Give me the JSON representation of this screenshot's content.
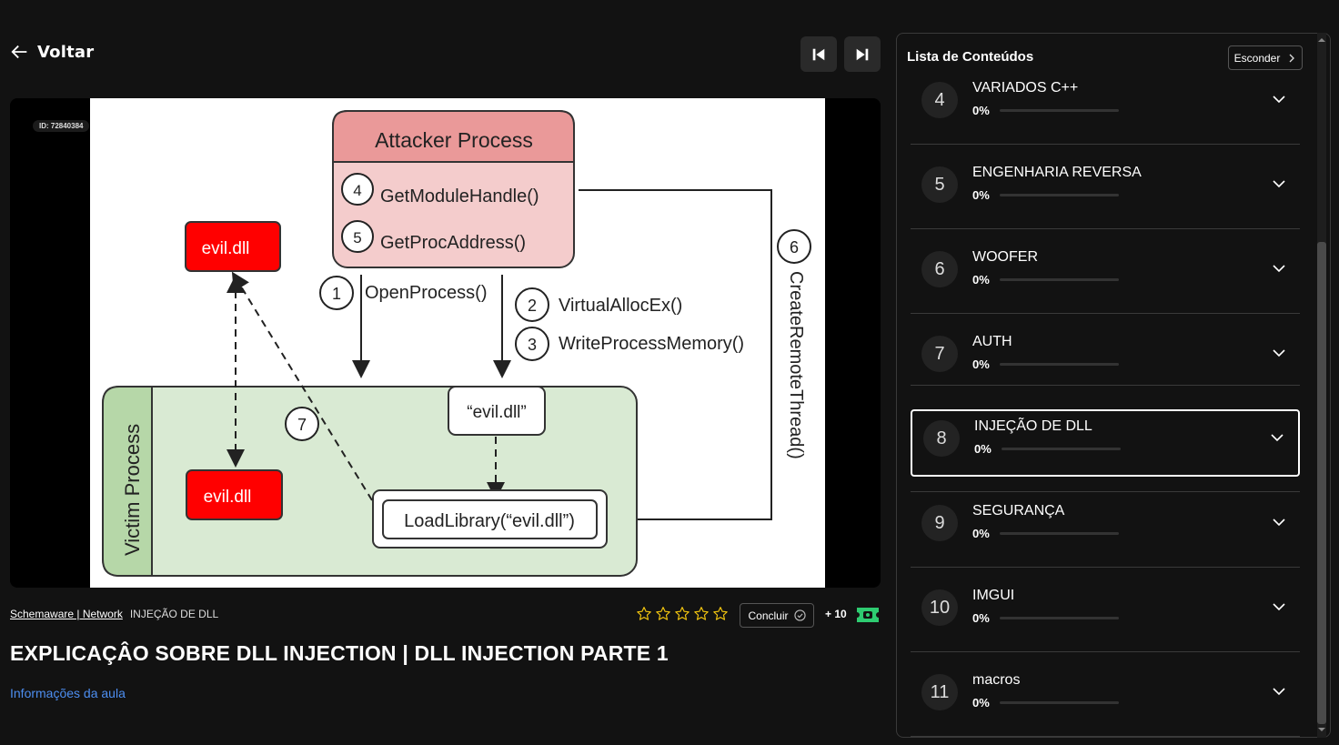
{
  "header": {
    "back_label": "Voltar"
  },
  "video": {
    "watermark": "ID: 72840384",
    "diagram": {
      "attacker_title": "Attacker Process",
      "attacker_fn1_num": "4",
      "attacker_fn1": "GetModuleHandle()",
      "attacker_fn2_num": "5",
      "attacker_fn2": "GetProcAddress()",
      "evil_top": "evil.dll",
      "step1_num": "1",
      "step1": "OpenProcess()",
      "step2_num": "2",
      "step2": "VirtualAllocEx()",
      "step3_num": "3",
      "step3": "WriteProcessMemory()",
      "step6_num": "6",
      "step6": "CreateRemoteThread()",
      "step7_num": "7",
      "victim_title": "Victim Process",
      "evil_quoted": "“evil.dll”",
      "evil_victim": "evil.dll",
      "loadlib": "LoadLibrary(“evil.dll”)"
    }
  },
  "breadcrumb": {
    "course": "Schemaware | Network",
    "module": "INJEÇÃO DE DLL"
  },
  "rating": {
    "stars": 0,
    "max": 5
  },
  "actions": {
    "conclude_label": "Concluir",
    "points": "+ 10"
  },
  "lesson": {
    "title": "EXPLICAÇÂO SOBRE DLL INJECTION | DLL INJECTION PARTE 1",
    "info_link": "Informações da aula"
  },
  "sidebar": {
    "title": "Lista de Conteúdos",
    "hide_label": "Esconder",
    "modules": [
      {
        "num": "4",
        "name": "VARIADOS C++",
        "progress": "0%",
        "selected": false
      },
      {
        "num": "5",
        "name": "ENGENHARIA REVERSA",
        "progress": "0%",
        "selected": false
      },
      {
        "num": "6",
        "name": "WOOFER",
        "progress": "0%",
        "selected": false
      },
      {
        "num": "7",
        "name": "AUTH",
        "progress": "0%",
        "selected": false
      },
      {
        "num": "8",
        "name": "INJEÇÃO DE DLL",
        "progress": "0%",
        "selected": true
      },
      {
        "num": "9",
        "name": "SEGURANÇA",
        "progress": "0%",
        "selected": false
      },
      {
        "num": "10",
        "name": "IMGUI",
        "progress": "0%",
        "selected": false
      },
      {
        "num": "11",
        "name": "macros",
        "progress": "0%",
        "selected": false
      }
    ]
  },
  "colors": {
    "accent": "#4d8ef0",
    "attacker_fill": "#f4cccc",
    "attacker_head": "#ea9999",
    "victim_fill": "#d9ead3",
    "evil_red": "#ff0000",
    "ticket_green": "#2ecc71"
  }
}
